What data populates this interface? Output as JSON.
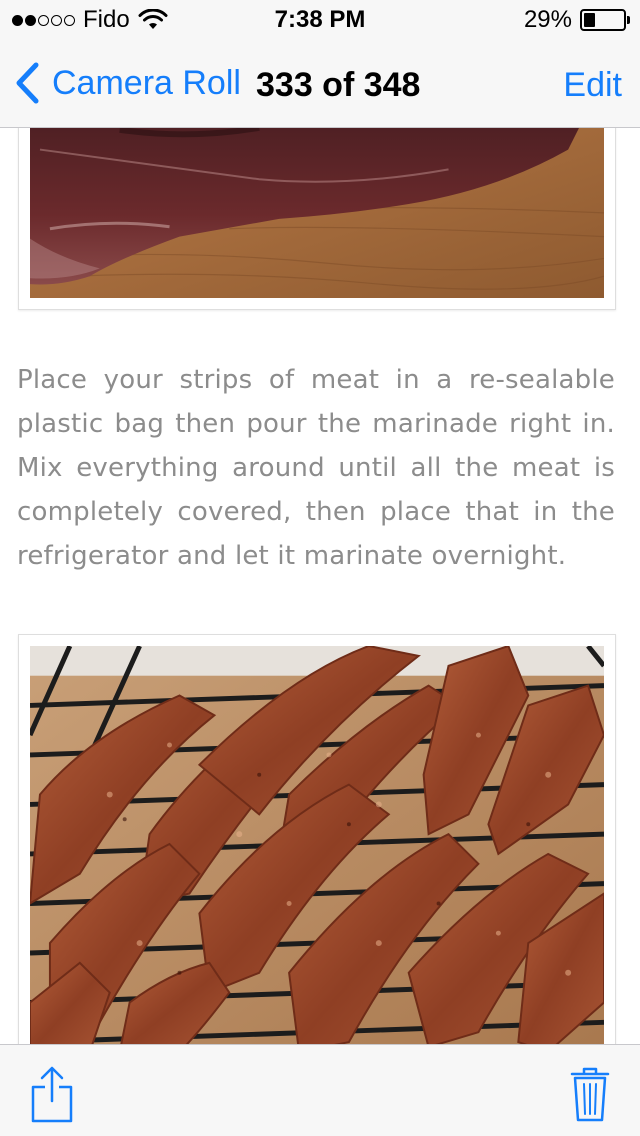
{
  "status_bar": {
    "signal_dots_filled": 2,
    "signal_dots_total": 5,
    "carrier": "Fido",
    "wifi_icon": "wifi-icon",
    "time": "7:38 PM",
    "battery_percent": "29%",
    "battery_level": 0.29
  },
  "nav_bar": {
    "back_icon": "chevron-left-icon",
    "back_label": "Camera Roll",
    "title": "333 of 348",
    "edit_label": "Edit"
  },
  "content": {
    "top_photo": "raw marinated beef in plastic bag on wooden board",
    "paragraph": "Place your strips of meat in a re-sealable plastic bag then pour the marinade right in. Mix everything around until all the meat is completely covered, then place that in the refrigerator and let it marinate overnight.",
    "bottom_photo": "marinated beef strips on wire rack"
  },
  "toolbar": {
    "share_icon": "share-icon",
    "trash_icon": "trash-icon"
  },
  "colors": {
    "accent": "#157efb",
    "bar_background": "#f7f7f7",
    "paragraph_text": "#8c8c8c"
  }
}
